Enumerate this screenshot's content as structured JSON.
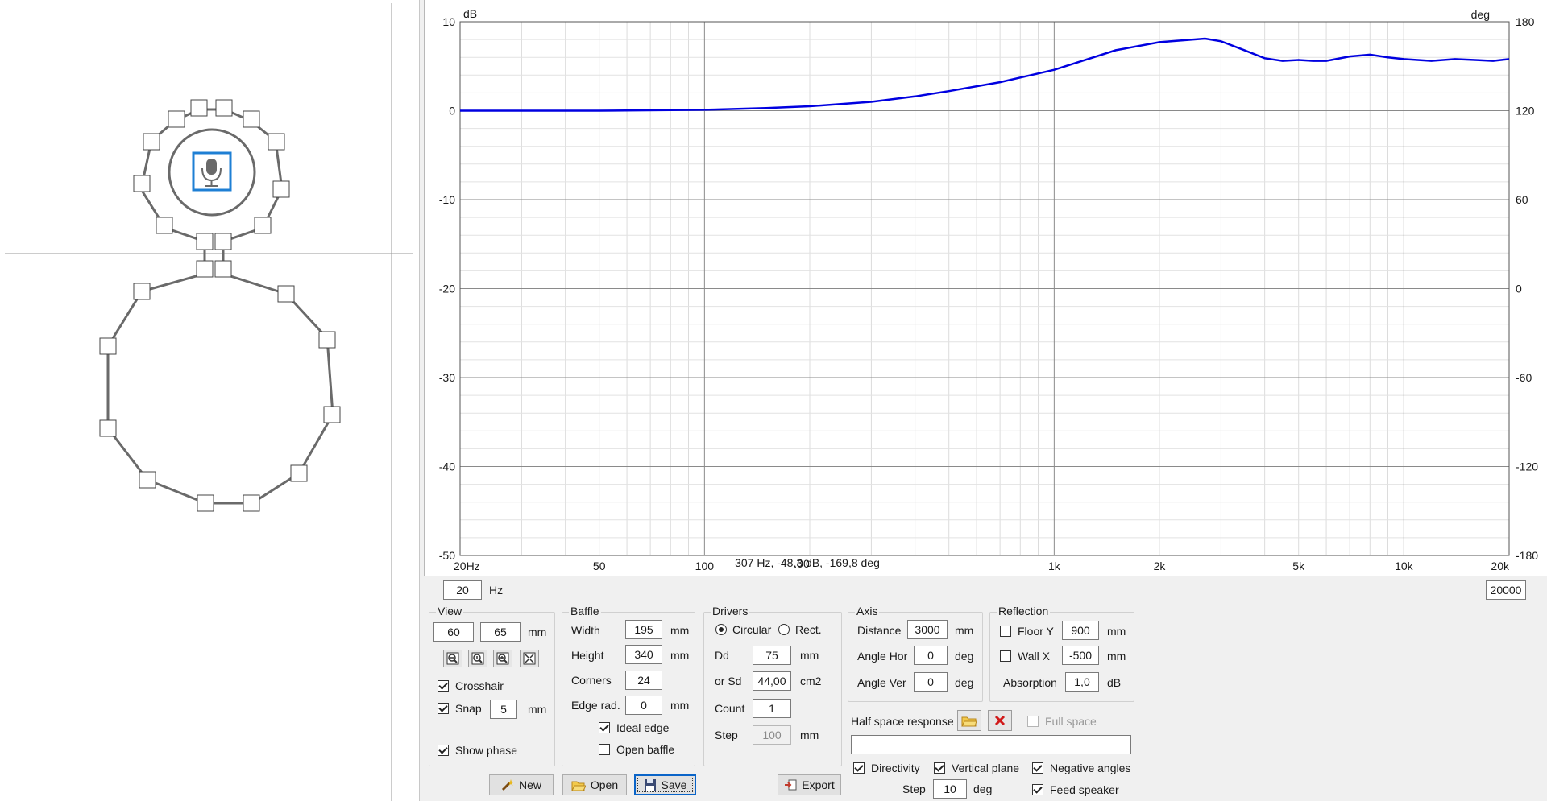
{
  "graph": {
    "unit_left": "dB",
    "unit_right": "deg",
    "left_ticks": [
      "10",
      "0",
      "-10",
      "-20",
      "-30",
      "-40",
      "-50"
    ],
    "right_ticks": [
      "180",
      "120",
      "60",
      "0",
      "-60",
      "-120",
      "-180"
    ],
    "x_ticks": [
      "20Hz",
      "50",
      "100",
      "1k",
      "2k",
      "5k",
      "10k",
      "20k"
    ],
    "cursor_readout": "307 Hz, -48,3 dB, -169,8 deg",
    "cursor_tick": ".00",
    "freq_min": "20",
    "freq_unit": "Hz",
    "freq_max": "20000",
    "curve_color": "#0000e0"
  },
  "chart_data": {
    "type": "line",
    "x_scale": "log",
    "xlim": [
      20,
      20000
    ],
    "ylim": [
      -50,
      10
    ],
    "y2lim": [
      -180,
      180
    ],
    "ylabel": "dB",
    "y2label": "deg",
    "xlabel": "Hz",
    "grid": true,
    "series": [
      {
        "x": [
          20,
          50,
          100,
          150,
          200,
          300,
          400,
          500,
          700,
          1000,
          1500,
          2000,
          2700,
          3000,
          3500,
          4000,
          4500,
          5000,
          5500,
          6000,
          7000,
          8000,
          9000,
          10000,
          12000,
          14000,
          16000,
          18000,
          20000
        ],
        "y": [
          0,
          0,
          0.1,
          0.3,
          0.5,
          1.0,
          1.6,
          2.2,
          3.2,
          4.6,
          6.8,
          7.7,
          8.1,
          7.8,
          6.8,
          5.9,
          5.6,
          5.7,
          5.6,
          5.6,
          6.1,
          6.3,
          6.0,
          5.8,
          5.6,
          5.8,
          5.7,
          5.6,
          5.8
        ]
      }
    ]
  },
  "view": {
    "title": "View",
    "x": "60",
    "y": "65",
    "unit": "mm",
    "crosshair_label": "Crosshair",
    "crosshair": true,
    "snap_label": "Snap",
    "snap": true,
    "snap_value": "5",
    "snap_unit": "mm",
    "show_phase_label": "Show phase",
    "show_phase": true,
    "zoom_icons": [
      "zoom-out-icon",
      "zoom-fit-icon",
      "zoom-in-icon",
      "full-view-icon"
    ]
  },
  "baffle": {
    "title": "Baffle",
    "width_label": "Width",
    "width": "195",
    "width_unit": "mm",
    "height_label": "Height",
    "height": "340",
    "height_unit": "mm",
    "corners_label": "Corners",
    "corners": "24",
    "edge_label": "Edge rad.",
    "edge": "0",
    "edge_unit": "mm",
    "ideal_edge_label": "Ideal edge",
    "ideal_edge": true,
    "open_baffle_label": "Open baffle",
    "open_baffle": false
  },
  "drivers": {
    "title": "Drivers",
    "circular_label": "Circular",
    "rect_label": "Rect.",
    "shape": "circular",
    "dd_label": "Dd",
    "dd": "75",
    "dd_unit": "mm",
    "sd_label": "or Sd",
    "sd": "44,00",
    "sd_unit": "cm2",
    "count_label": "Count",
    "count": "1",
    "step_label": "Step",
    "step": "100",
    "step_unit": "mm"
  },
  "axis": {
    "title": "Axis",
    "distance_label": "Distance",
    "distance": "3000",
    "distance_unit": "mm",
    "angle_hor_label": "Angle Hor",
    "angle_hor": "0",
    "angle_hor_unit": "deg",
    "angle_ver_label": "Angle Ver",
    "angle_ver": "0",
    "angle_ver_unit": "deg"
  },
  "reflection": {
    "title": "Reflection",
    "floor_label": "Floor Y",
    "floor": false,
    "floor_value": "900",
    "floor_unit": "mm",
    "wall_label": "Wall  X",
    "wall": false,
    "wall_value": "-500",
    "wall_unit": "mm",
    "absorption_label": "Absorption",
    "absorption": "1,0",
    "absorption_unit": "dB"
  },
  "half_space": {
    "label": "Half space response",
    "full_space_label": "Full space",
    "full_space": false,
    "path": ""
  },
  "options": {
    "directivity_label": "Directivity",
    "directivity": true,
    "vertical_label": "Vertical plane",
    "vertical": true,
    "negative_label": "Negative angles",
    "negative": true,
    "step_label": "Step",
    "step": "10",
    "step_unit": "deg",
    "feed_label": "Feed speaker",
    "feed": true
  },
  "buttons": {
    "new": "New",
    "open": "Open",
    "save": "Save",
    "export": "Export"
  }
}
